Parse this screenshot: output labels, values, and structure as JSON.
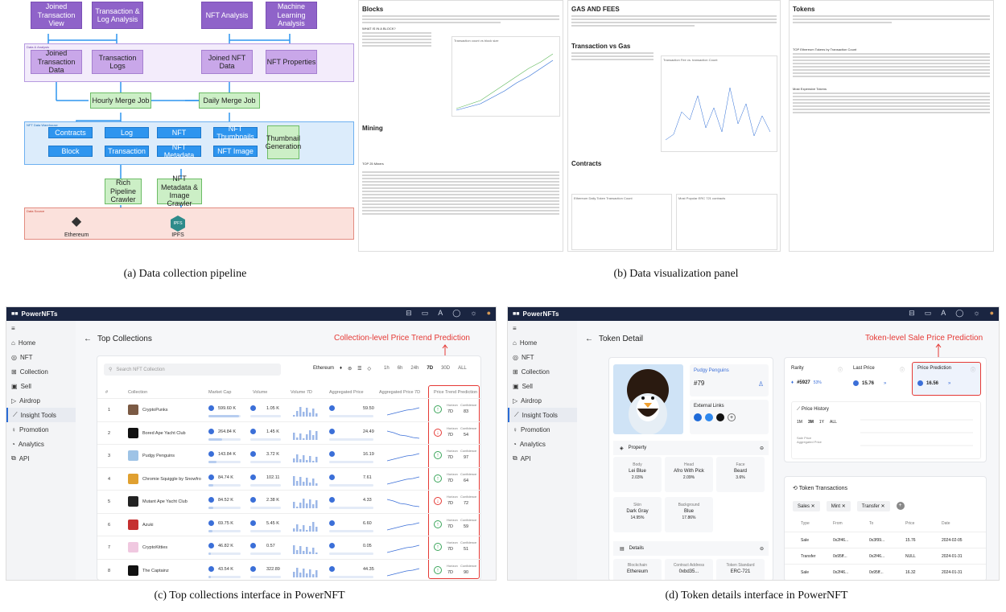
{
  "captions": {
    "a": "(a)  Data collection pipeline",
    "b": "(b)  Data visualization panel",
    "c": "(c)  Top collections interface in PowerNFT",
    "d": "(d)  Token details interface in PowerNFT"
  },
  "pipeline": {
    "top_nodes": [
      "Joined Transaction View",
      "Transaction & Log Analysis",
      "NFT Analysis",
      "Machine Learning Analysis"
    ],
    "mid_nodes": [
      "Joined Transaction Data",
      "Transaction Logs",
      "Joined NFT Data",
      "NFT Properties"
    ],
    "jobs": [
      "Hourly Merge Job",
      "Daily  Merge Job"
    ],
    "blue_row1": [
      "Contracts",
      "Log",
      "NFT",
      "NFT Thumbnails"
    ],
    "blue_row2": [
      "Block",
      "Transaction",
      "NFT Metadata",
      "NFT Image"
    ],
    "thumb_gen": "Thumbnail Generation",
    "crawlers": [
      "Rich Pipeline Crawler",
      "NFT Metadata & Image Crawler"
    ],
    "sources": [
      "Ethereum",
      "IPFS"
    ],
    "ipfs_logo": "IPFS",
    "grp_labels": [
      "Data & Analysis",
      "NFT Data Warehouse",
      "Data Source"
    ]
  },
  "panel": {
    "col1": {
      "h1": "Blocks",
      "sub": "WHAT IS IN A BLOCK?",
      "chart1": "Transaction count vs block size",
      "h2": "Mining",
      "sub2": "TOP 25 Miners",
      "legend": [
        "Average Transactions",
        "Average block size"
      ]
    },
    "col2": {
      "h1": "GAS AND FEES",
      "h2": "Transaction vs Gas",
      "chart1": "Transaction Fee vs. transaction Count",
      "h3": "Contracts",
      "chart2": "Ethereum Daily Token Transaction Count",
      "chart3": "Most Popular ERC 721 contracts"
    },
    "col3": {
      "h1": "Tokens",
      "sub1": "TOP Ethereum Tokens by Transaction Count",
      "sub2": "Most Expensive Tokens"
    }
  },
  "app_c": {
    "brand": "PowerNFTs",
    "nav": [
      "Home",
      "NFT",
      "Collection",
      "Sell",
      "Airdrop",
      "Insight Tools",
      "Promotion",
      "Analytics",
      "API"
    ],
    "nav_active": "Insight Tools",
    "title": "Top Collections",
    "annotation": "Collection-level Price Trend Prediction",
    "search_placeholder": "Search NFT Collection",
    "chain": "Ethereum",
    "ranges": [
      "1h",
      "6h",
      "24h",
      "7D",
      "30D",
      "ALL"
    ],
    "range_active": "7D",
    "columns": [
      "#",
      "Collection",
      "Market Cap",
      "Volume",
      "Volume 7D",
      "Aggregated Price",
      "Aggregated Price 7D",
      "Price Trend Prediction"
    ],
    "horizon_label": "Horizon",
    "confidence_label": "Confidence",
    "rows": [
      {
        "rank": "1",
        "name": "CryptoPunks",
        "cap": "599.60 K",
        "vol": "1.05 K",
        "price": "59.50",
        "up": true,
        "horizon": "7D",
        "conf": "83"
      },
      {
        "rank": "2",
        "name": "Bored Ape Yacht Club",
        "cap": "264.84 K",
        "vol": "1.45 K",
        "price": "24.49",
        "up": false,
        "horizon": "7D",
        "conf": "54"
      },
      {
        "rank": "3",
        "name": "Pudgy Penguins",
        "cap": "143.84 K",
        "vol": "3.72 K",
        "price": "16.19",
        "up": true,
        "horizon": "7D",
        "conf": "97"
      },
      {
        "rank": "4",
        "name": "Chromie Squiggle by Snowfro",
        "cap": "84.74 K",
        "vol": "102.11",
        "price": "7.61",
        "up": true,
        "horizon": "7D",
        "conf": "64"
      },
      {
        "rank": "5",
        "name": "Mutant Ape Yacht Club",
        "cap": "84.52 K",
        "vol": "2.38 K",
        "price": "4.33",
        "up": false,
        "horizon": "7D",
        "conf": "72"
      },
      {
        "rank": "6",
        "name": "Azuki",
        "cap": "69.75 K",
        "vol": "5.45 K",
        "price": "6.60",
        "up": true,
        "horizon": "7D",
        "conf": "59"
      },
      {
        "rank": "7",
        "name": "CryptoKitties",
        "cap": "46.82 K",
        "vol": "0.57",
        "price": "0.05",
        "up": true,
        "horizon": "7D",
        "conf": "51"
      },
      {
        "rank": "8",
        "name": "The Captainz",
        "cap": "43.54 K",
        "vol": "322.89",
        "price": "44.35",
        "up": true,
        "horizon": "7D",
        "conf": "90"
      }
    ]
  },
  "app_d": {
    "brand": "PowerNFTs",
    "title": "Token Detail",
    "annotation": "Token-level Sale Price Prediction",
    "collection": "Pudgy Penguins",
    "token_id": "#79",
    "external_links": "External Links",
    "property": "Property",
    "props": [
      {
        "k": "Body",
        "v": "Lei Blue",
        "p": "2.03%"
      },
      {
        "k": "Head",
        "v": "Afro With Pick",
        "p": "2.09%"
      },
      {
        "k": "Face",
        "v": "Beard",
        "p": "3.6%"
      },
      {
        "k": "Skin",
        "v": "Dark Gray",
        "p": "14.95%"
      },
      {
        "k": "Background",
        "v": "Blue",
        "p": "17.86%"
      }
    ],
    "details": "Details",
    "detail_fields": [
      {
        "k": "Blockchain",
        "v": "Ethereum"
      },
      {
        "k": "Contract Address",
        "v": "0xbd35..."
      },
      {
        "k": "Token Standard",
        "v": "ERC-721"
      }
    ],
    "rarity_label": "Rarity",
    "rarity_rank": "#5927",
    "rarity_pct": "53%",
    "last_price_label": "Last Price",
    "last_price": "15.76",
    "pred_label": "Price Prediction",
    "pred_value": "16.56",
    "history_title": "Price History",
    "history_ranges": [
      "1M",
      "3M",
      "1Y",
      "ALL"
    ],
    "history_active": "3M",
    "history_legend": [
      "Sale Price",
      "Aggregated Price"
    ],
    "tx_title": "Token Transactions",
    "filters": [
      "Sales",
      "Mint",
      "Transfer"
    ],
    "tx_columns": [
      "Type",
      "From",
      "To",
      "Price",
      "Date"
    ],
    "tx_rows": [
      {
        "type": "Sale",
        "from": "0x2f46...",
        "to": "0x3f99...",
        "price": "15.76",
        "date": "2024-02-05"
      },
      {
        "type": "Transfer",
        "from": "0x95ff...",
        "to": "0x2f46...",
        "price": "NULL",
        "date": "2024-01-31"
      },
      {
        "type": "Sale",
        "from": "0x2f46...",
        "to": "0x95ff...",
        "price": "16.32",
        "date": "2024-01-31"
      }
    ]
  }
}
